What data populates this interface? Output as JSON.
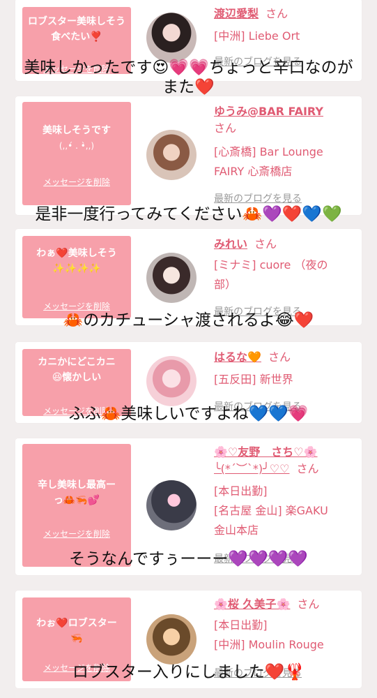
{
  "cards": [
    {
      "message": "ロブスター美味しそう食べたい❣️",
      "delete_label": "メッセージを削除",
      "name": "渡辺愛梨",
      "honorific": "さん",
      "shop_lines": [
        "[中洲] Liebe Ort"
      ],
      "blog_label": "最新のブログを見る"
    },
    {
      "message": "美味しそうです",
      "message_sub": "(,,•́ . •̀,,)",
      "delete_label": "メッセージを削除",
      "name": "ゆうみ@BAR FAIRY",
      "honorific": "さん",
      "shop_lines": [
        "[心斎橋] Bar Lounge",
        "FAIRY 心斎橋店"
      ],
      "blog_label": "最新のブログを見る"
    },
    {
      "message": "わぁ❤️美味しそう",
      "message_sub": "✨✨✨✨",
      "delete_label": "メッセージを削除",
      "name": "みれい",
      "honorific": "さん",
      "shop_lines": [
        "[ミナミ] cuore （夜の",
        "部）"
      ],
      "blog_label": "最新のブログを見る"
    },
    {
      "message": "カニかにどこカニ",
      "message_sub": "😆懐かしい",
      "delete_label": "メッセージを削除",
      "name": "はるな🧡",
      "honorific": "さん",
      "shop_lines": [
        "[五反田] 新世界"
      ],
      "blog_label": "最新のブログを見る"
    },
    {
      "message": "辛し美味し最高ー",
      "message_sub": "っ🦀🦐💕",
      "delete_label": "メッセージを削除",
      "name": "🌸♡友野　さち♡🌸",
      "name_line2": "╰(*´︶`*)╯♡♡",
      "honorific": "さん",
      "shop_lines": [
        "[本日出勤]",
        "[名古屋 金山] 楽GAKU",
        "金山本店"
      ],
      "blog_label": "最新のブログを見る"
    },
    {
      "message": "わぉ❤️ロブスター",
      "message_sub": "🦐",
      "delete_label": "メッセージを削除",
      "name": "🌸桜 久美子🌸",
      "honorific": "さん",
      "shop_lines": [
        "[本日出勤]",
        "[中洲] Moulin Rouge"
      ],
      "blog_label": "最新のブログを見る"
    }
  ],
  "captions": [
    "美味しかったです😍💗💗ちょっと辛口なのが",
    "また❤️",
    "是非一度行ってみてください🦀💜❤️💙💚",
    "🦀のカチューシャ渡されるよ😂❤️",
    "ふふ🦀美味しいですよね💙💙💗",
    "そうなんですぅーーー💜💜💜💜",
    "ロブスター入りにしました❤️🦞"
  ],
  "colors": {
    "accent": "#e05b73",
    "bubble": "#f7a0aa",
    "background": "#f2eeee"
  }
}
